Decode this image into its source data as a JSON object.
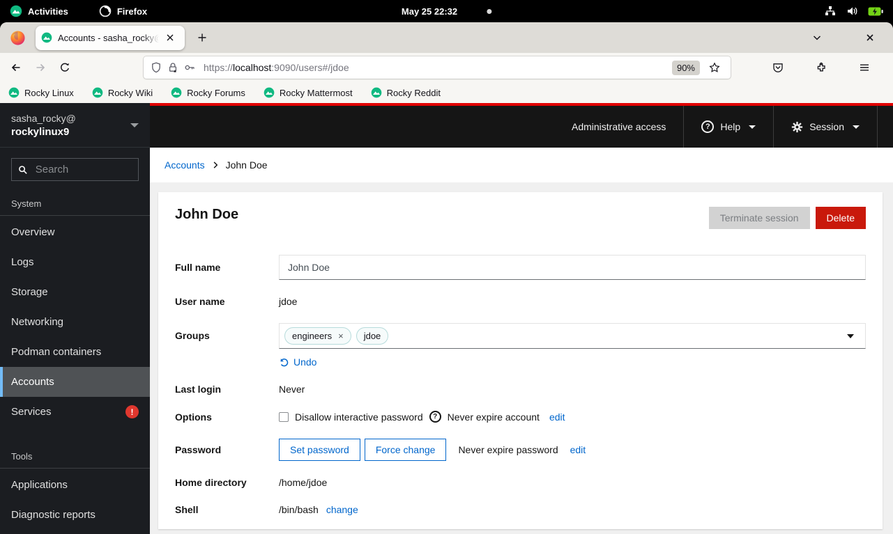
{
  "colors": {
    "accent_blue": "#0066cc",
    "danger_red": "#c9190b",
    "rocky_green": "#10b981",
    "nav_selected_border": "#73bcf7",
    "masthead_red": "#ee0000",
    "badge_red": "#e0372e"
  },
  "gnome_bar": {
    "activities_label": "Activities",
    "app_label": "Firefox",
    "clock": "May 25 22:32"
  },
  "browser": {
    "tab_title": "Accounts - sasha_rocky@",
    "zoom_badge": "90%",
    "url": {
      "scheme": "https://",
      "host": "localhost",
      "path": ":9090/users#/jdoe"
    },
    "bookmarks": [
      "Rocky Linux",
      "Rocky Wiki",
      "Rocky Forums",
      "Rocky Mattermost",
      "Rocky Reddit"
    ]
  },
  "sidebar": {
    "user": "sasha_rocky@",
    "host": "rockylinux9",
    "search_placeholder": "Search",
    "system_section_label": "System",
    "system_items": [
      "Overview",
      "Logs",
      "Storage",
      "Networking",
      "Podman containers",
      "Accounts",
      "Services"
    ],
    "selected_item": "Accounts",
    "services_badge": "!",
    "tools_section_label": "Tools",
    "tools_items": [
      "Applications",
      "Diagnostic reports"
    ]
  },
  "masthead": {
    "admin_access_label": "Administrative access",
    "help_label": "Help",
    "help_glyph": "?",
    "session_label": "Session"
  },
  "breadcrumb": {
    "parent": "Accounts",
    "current": "John Doe"
  },
  "account": {
    "title": "John Doe",
    "terminate_button": "Terminate session",
    "delete_button": "Delete",
    "full_name_label": "Full name",
    "full_name_value": "John Doe",
    "user_name_label": "User name",
    "user_name_value": "jdoe",
    "groups_label": "Groups",
    "group_chip_1": "engineers",
    "group_chip_1_close": "×",
    "group_chip_2": "jdoe",
    "undo_label": "Undo",
    "last_login_label": "Last login",
    "last_login_value": "Never",
    "options_label": "Options",
    "options_checkbox_label": "Disallow interactive password",
    "options_help_glyph": "?",
    "options_expire_text": "Never expire account",
    "options_edit_label": "edit",
    "password_label": "Password",
    "set_password_button": "Set password",
    "force_change_button": "Force change",
    "password_expire_text": "Never expire password",
    "password_edit_label": "edit",
    "home_dir_label": "Home directory",
    "home_dir_value": "/home/jdoe",
    "shell_label": "Shell",
    "shell_value": "/bin/bash",
    "shell_change_label": "change"
  }
}
